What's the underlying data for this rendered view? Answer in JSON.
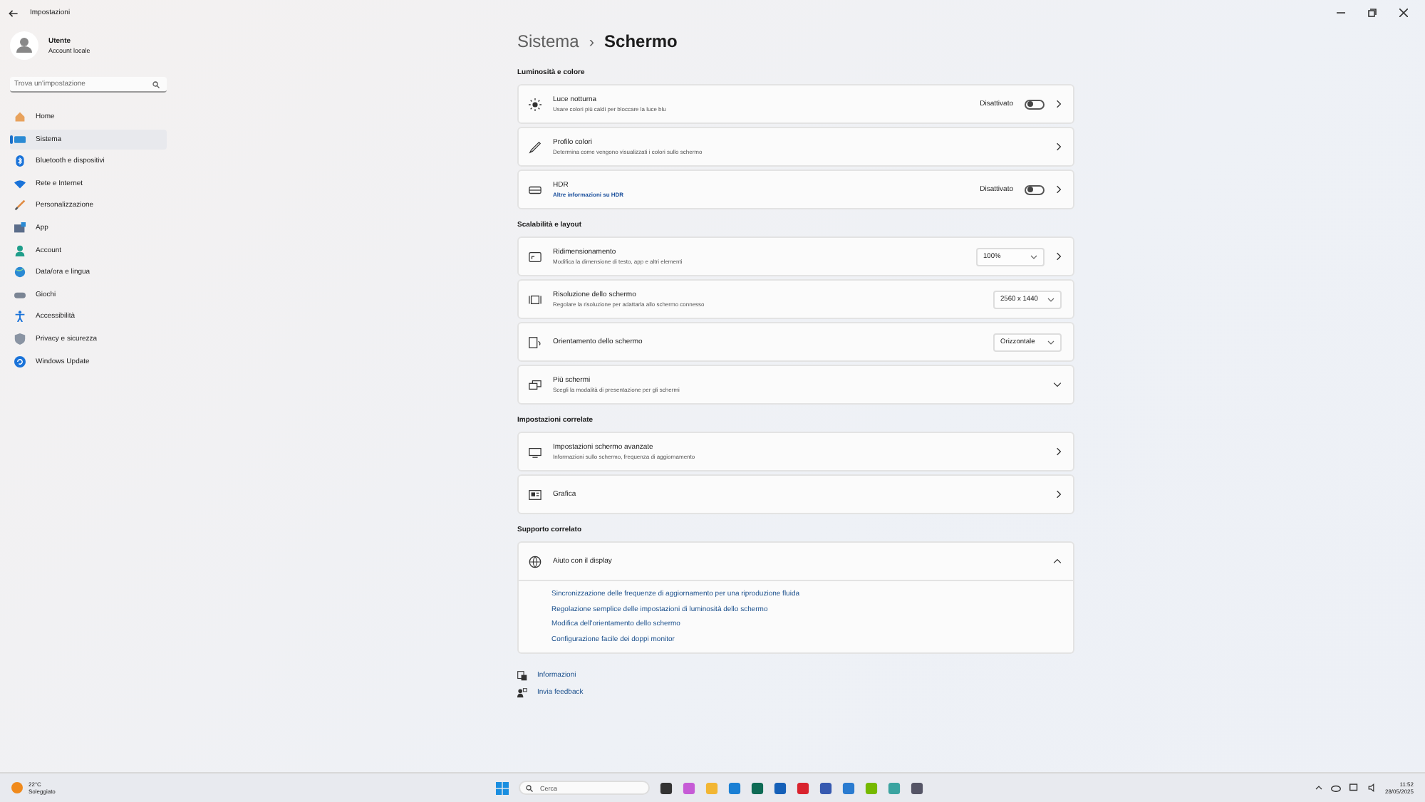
{
  "window": {
    "title": "Impostazioni"
  },
  "user": {
    "name": "Utente",
    "account": "Account locale"
  },
  "search": {
    "placeholder": "Trova un'impostazione"
  },
  "sidebar": {
    "items": [
      {
        "label": "Home",
        "selected": false
      },
      {
        "label": "Sistema",
        "selected": true
      },
      {
        "label": "Bluetooth e dispositivi",
        "selected": false
      },
      {
        "label": "Rete e Internet",
        "selected": false
      },
      {
        "label": "Personalizzazione",
        "selected": false
      },
      {
        "label": "App",
        "selected": false
      },
      {
        "label": "Account",
        "selected": false
      },
      {
        "label": "Data/ora e lingua",
        "selected": false
      },
      {
        "label": "Giochi",
        "selected": false
      },
      {
        "label": "Accessibilità",
        "selected": false
      },
      {
        "label": "Privacy e sicurezza",
        "selected": false
      },
      {
        "label": "Windows Update",
        "selected": false
      }
    ]
  },
  "breadcrumb": {
    "parent": "Sistema",
    "separator": "›",
    "current": "Schermo"
  },
  "sections": [
    {
      "title": "Luminosità e colore",
      "rows": [
        {
          "kind": "toggle",
          "title": "Luce notturna",
          "subtitle": "Usare colori più caldi per bloccare la luce blu",
          "state_text": "Disattivato",
          "on": false
        },
        {
          "kind": "link",
          "title": "Profilo colori",
          "subtitle": "Determina come vengono visualizzati i colori sullo schermo"
        },
        {
          "kind": "toggle",
          "title": "HDR",
          "subtitle_link": "Altre informazioni su HDR",
          "state_text": "Disattivato",
          "on": false
        }
      ]
    },
    {
      "title": "Scalabilità e layout",
      "rows": [
        {
          "kind": "dropdown_link",
          "title": "Ridimensionamento",
          "subtitle": "Modifica la dimensione di testo, app e altri elementi",
          "value": "100%"
        },
        {
          "kind": "dropdown",
          "title": "Risoluzione dello schermo",
          "subtitle": "Regolare la risoluzione per adattarla allo schermo connesso",
          "value": "2560 x 1440"
        },
        {
          "kind": "dropdown",
          "title": "Orientamento dello schermo",
          "value": "Orizzontale"
        },
        {
          "kind": "expander",
          "title": "Più schermi",
          "subtitle": "Scegli la modalità di presentazione per gli schermi",
          "expanded": false
        }
      ]
    },
    {
      "title": "Impostazioni correlate",
      "rows": [
        {
          "kind": "link",
          "title": "Impostazioni schermo avanzate",
          "subtitle": "Informazioni sullo schermo, frequenza di aggiornamento"
        },
        {
          "kind": "link",
          "title": "Grafica"
        }
      ]
    },
    {
      "title": "Supporto correlato",
      "rows": [
        {
          "kind": "expander",
          "title": "Aiuto con il display",
          "expanded": true,
          "links": [
            "Sincronizzazione delle frequenze di aggiornamento per una riproduzione fluida",
            "Regolazione semplice delle impostazioni di luminosità dello schermo",
            "Modifica dell'orientamento dello schermo",
            "Configurazione facile dei doppi monitor"
          ]
        }
      ]
    }
  ],
  "footer_links": [
    "Informazioni",
    "Invia feedback"
  ],
  "taskbar": {
    "temperature": "22°C",
    "weather": "Soleggiato",
    "search_placeholder": "Cerca",
    "time": "11:52",
    "date": "28/05/2025"
  }
}
